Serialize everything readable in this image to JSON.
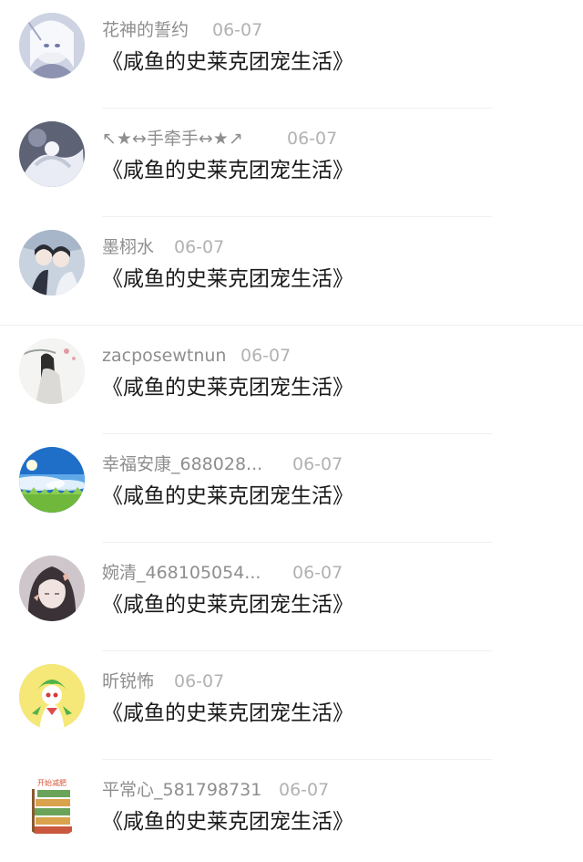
{
  "comments": [
    {
      "user": "花神的誓约",
      "date": "06-07",
      "text": "《咸鱼的史莱克团宠生活》",
      "avatar": "anime-white-hair-avatar"
    },
    {
      "user": "↖★↔手牵手↔★↗",
      "date": "06-07",
      "text": "《咸鱼的史莱克团宠生活》",
      "avatar": "anime-white-robe-avatar"
    },
    {
      "user": "墨栩水",
      "date": "06-07",
      "text": "《咸鱼的史莱克团宠生活》",
      "avatar": "anime-couple-avatar"
    },
    {
      "user": "zacposewtnun",
      "date": "06-07",
      "text": "《咸鱼的史莱克团宠生活》",
      "avatar": "ink-painting-avatar"
    },
    {
      "user": "幸福安康_688028...",
      "date": "06-07",
      "text": "《咸鱼的史莱克团宠生活》",
      "avatar": "blue-sky-grass-avatar"
    },
    {
      "user": "婉清_468105054...",
      "date": "06-07",
      "text": "《咸鱼的史莱克团宠生活》",
      "avatar": "girl-butterfly-avatar"
    },
    {
      "user": "昕锐怖",
      "date": "06-07",
      "text": "《咸鱼的史莱克团宠生活》",
      "avatar": "green-cartoon-avatar"
    },
    {
      "user": "平常心_581798731",
      "date": "06-07",
      "text": "《咸鱼的史莱克团宠生活》",
      "avatar": "weight-loss-sign-avatar"
    }
  ],
  "sign_avatar_text": "开始减肥"
}
